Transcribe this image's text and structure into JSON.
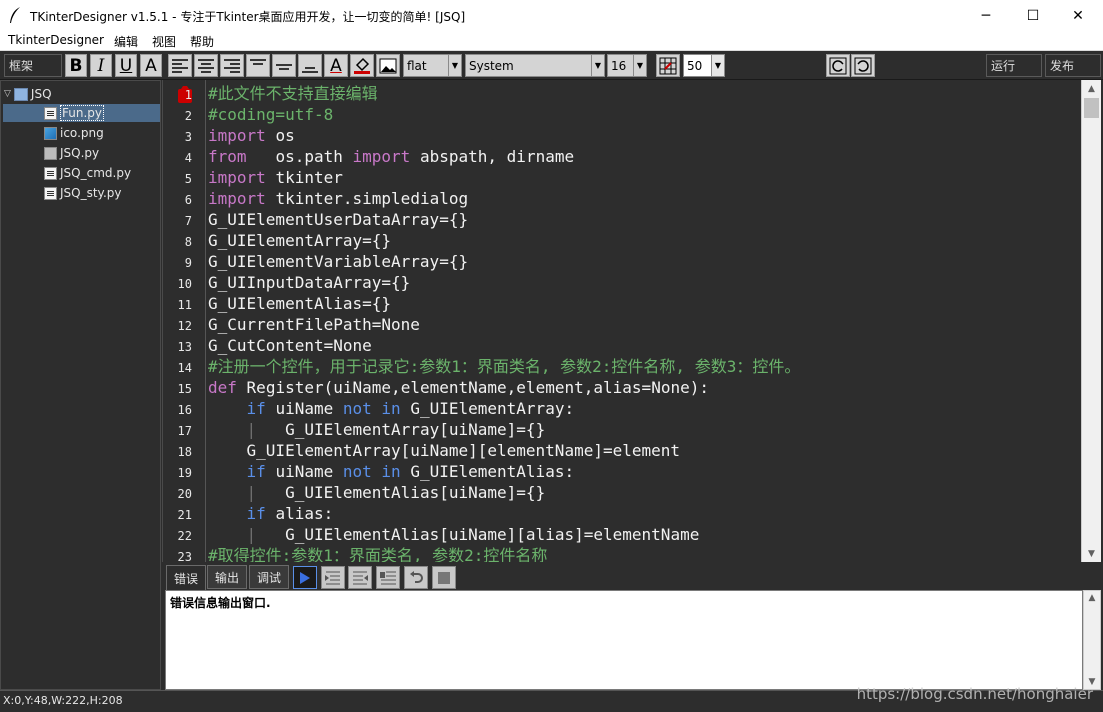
{
  "window": {
    "title": "TKinterDesigner v1.5.1 - 专注于Tkinter桌面应用开发，让一切变的简单!    [JSQ]",
    "minimize": "─",
    "maximize": "☐",
    "close": "✕"
  },
  "menu": [
    "TkinterDesigner",
    "编辑",
    "视图",
    "帮助"
  ],
  "toolbar": {
    "frame_label": "框架",
    "bold": "B",
    "italic": "I",
    "underline": "U",
    "font_a": "A",
    "font_color": "A",
    "relief": "flat",
    "font_family": "System",
    "font_size": "16",
    "scale": "50",
    "run": "运行",
    "publish": "发布"
  },
  "tree": {
    "project": "JSQ",
    "files": [
      "Fun.py",
      "ico.png",
      "JSQ.py",
      "JSQ_cmd.py",
      "JSQ_sty.py"
    ],
    "selected": "Fun.py"
  },
  "editor": {
    "line_numbers": [
      "1",
      "2",
      "3",
      "4",
      "5",
      "6",
      "7",
      "8",
      "9",
      "10",
      "11",
      "12",
      "13",
      "14",
      "15",
      "16",
      "17",
      "18",
      "19",
      "20",
      "21",
      "22",
      "23"
    ],
    "lines": [
      "#此文件不支持直接编辑",
      "#coding=utf-8",
      "import os",
      "from   os.path import abspath, dirname",
      "import tkinter",
      "import tkinter.simpledialog",
      "G_UIElementUserDataArray={}",
      "G_UIElementArray={}",
      "G_UIElementVariableArray={}",
      "G_UIInputDataArray={}",
      "G_UIElementAlias={}",
      "G_CurrentFilePath=None",
      "G_CutContent=None",
      "#注册一个控件，用于记录它:参数1：界面类名, 参数2:控件名称, 参数3：控件。",
      "def Register(uiName,elementName,element,alias=None):",
      "    if uiName not in G_UIElementArray:",
      "    |   G_UIElementArray[uiName]={}",
      "    G_UIElementArray[uiName][elementName]=element",
      "    if uiName not in G_UIElementAlias:",
      "    |   G_UIElementAlias[uiName]={}",
      "    if alias:",
      "    |   G_UIElementAlias[uiName][alias]=elementName",
      "#取得控件:参数1：界面类名, 参数2:控件名称"
    ]
  },
  "bottom": {
    "tabs": [
      "错误",
      "输出",
      "调试"
    ],
    "active_tab": "错误",
    "output_text": "错误信息输出窗口."
  },
  "status": {
    "text": "X:0,Y:48,W:222,H:208",
    "watermark": "https://blog.csdn.net/honghaier"
  },
  "colors": {
    "keyword": "#c878c8",
    "keyword2": "#5a8fe8",
    "comment": "#6bb36b",
    "background": "#2d2d2d"
  }
}
